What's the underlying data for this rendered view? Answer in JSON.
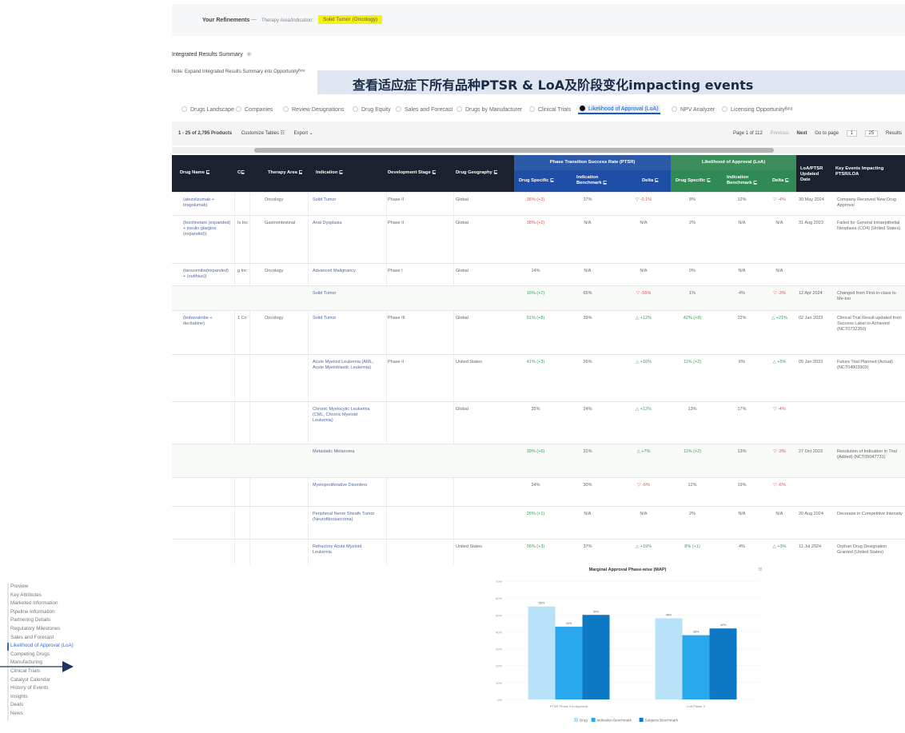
{
  "refinements": {
    "label": "Your Refinements",
    "separator": "—",
    "path": "Therapy Area/Indication:",
    "tag": "Solid Tumor (Oncology)"
  },
  "results_title": "Integrated Results Summary",
  "note": "Note: Expand Integrated Results Summary into Opportunityᴮᵉᵗᵃ",
  "banner": "查看适应症下所有品种PTSR & LoA及阶段变化impacting events",
  "tabs": [
    "Drugs Landscape",
    "Companies",
    "Review Designations",
    "Drug Equity",
    "Sales and Forecast",
    "Drugs by Manufacturer",
    "Clinical Trials",
    "Likelihood of Approval (LoA)",
    "NPV Analyzer",
    "Licensing Opportunityᴮᵉᵗᵃ"
  ],
  "toolbar": {
    "count": "1 - 25 of 2,795 Products",
    "customize": "Customize Tables ☷",
    "export": "Export ⌄",
    "page_of": "Page 1 of 112",
    "previous": "Previous",
    "next": "Next",
    "goto": "Go to page",
    "page_value": "1",
    "per_page": "25",
    "results": "Results"
  },
  "table": {
    "headers": {
      "drug_name": "Drug Name ⊑",
      "company": "C⊑",
      "therapy_area": "Therapy Area ⊑",
      "indication": "Indication ⊑",
      "dev_stage": "Development Stage ⊑",
      "geography": "Drug Geography ⊑",
      "ptsr_group": "Phase Transition Success Rate (PTSR)",
      "loa_group": "Likelihood of Approval (LoA)",
      "drug_specific": "Drug Specific ⊑",
      "indication_bench": "Indication Benchmark ⊑",
      "delta": "Delta ⊑",
      "loa_updated": "LoA/PTSR Updated Date",
      "key_events": "Key Events Impacting PTSR/LOA"
    },
    "rows": [
      {
        "drug": "(atezolizumab + tiragolumab)",
        "company": "",
        "therapy": "Oncology",
        "indication": "Solid Tumor",
        "stage": "Phase II",
        "geo": "Global",
        "p_drug": "36% (+3)",
        "p_bench": "37%",
        "p_delta": "▽ -0.1%",
        "l_drug": "8%",
        "l_bench": "12%",
        "l_delta": "▽ -4%",
        "date": "30 May 2024",
        "event": "Company Received New Drug Approval"
      },
      {
        "drug": "(fezolinetant (expanded) + insulin glargine (expanded))",
        "company": "Is Inc",
        "therapy": "Gastrointestinal",
        "indication": "Anal Dysplasia",
        "stage": "Phase II",
        "geo": "Global",
        "p_drug": "38% (+2)",
        "p_bench": "N/A",
        "p_delta": "N/A",
        "l_drug": "2%",
        "l_bench": "N/A",
        "l_delta": "N/A",
        "date": "31 Aug 2023",
        "event": "Failed for General Intraepithelial Neoplasia (CO4) (United States)"
      },
      {
        "drug": "(tarozomibe(expanded) + (outthius))",
        "company": "g Inc",
        "therapy": "Oncology",
        "indication": "Advanced Malignancy",
        "stage": "Phase I",
        "geo": "Global",
        "p_drug": "14%",
        "p_bench": "N/A",
        "p_delta": "N/A",
        "l_drug": "0%",
        "l_bench": "N/A",
        "l_delta": "N/A",
        "date": "",
        "event": ""
      },
      {
        "drug": "",
        "company": "",
        "therapy": "",
        "indication": "Solid Tumor",
        "stage": "",
        "geo": "",
        "p_drug": "16% (+7)",
        "p_bench": "65%",
        "p_delta": "▽ -55%",
        "l_drug": "1%",
        "l_bench": "4%",
        "l_delta": "▽ -3%",
        "date": "12 Apr 2024",
        "event": "Changed from First-in-class to Me-too"
      },
      {
        "drug": "(bobavatinbe + decitabine)",
        "company": "1 Co",
        "therapy": "Oncology",
        "indication": "Solid Tumor",
        "stage": "Phase III",
        "geo": "Global",
        "p_drug": "51% (+8)",
        "p_bench": "39%",
        "p_delta": "△ +12%",
        "l_drug": "42% (+8)",
        "l_bench": "22%",
        "l_delta": "△ +21%",
        "date": "02 Jan 2023",
        "event": "Clinical Trial Result updated from Success Label to Achieved (NCT0732350)"
      },
      {
        "drug": "",
        "company": "",
        "therapy": "",
        "indication": "Acute Myeloid Leukemia (AML, Acute Myeloblastic Leukemia)",
        "stage": "Phase II",
        "geo": "United States",
        "p_drug": "41% (+3)",
        "p_bench": "26%",
        "p_delta": "△ +16%",
        "l_drug": "11% (+2)",
        "l_bench": "6%",
        "l_delta": "△ +5%",
        "date": "05 Jan 2023",
        "event": "Future Trial Planned (Actual) (NCT04803903)"
      },
      {
        "drug": "",
        "company": "",
        "therapy": "",
        "indication": "Chronic Myelocytic Leukemia (CML, Chronic Myeloid Leukemia)",
        "stage": "",
        "geo": "Global",
        "p_drug": "35%",
        "p_bench": "24%",
        "p_delta": "△ +12%",
        "l_drug": "13%",
        "l_bench": "17%",
        "l_delta": "▽ -4%",
        "date": "",
        "event": ""
      },
      {
        "drug": "",
        "company": "",
        "therapy": "",
        "indication": "Metastatic Melanoma",
        "stage": "",
        "geo": "",
        "p_drug": "39% (+6)",
        "p_bench": "31%",
        "p_delta": "△ +7%",
        "l_drug": "11% (+2)",
        "l_bench": "13%",
        "l_delta": "▽ -3%",
        "date": "27 Oct 2023",
        "event": "Resolution of Indication in Trial (Added) (NCT05047731)"
      },
      {
        "drug": "",
        "company": "",
        "therapy": "",
        "indication": "Myeloproliferative Disorders",
        "stage": "",
        "geo": "",
        "p_drug": "24%",
        "p_bench": "30%",
        "p_delta": "▽ -6%",
        "l_drug": "12%",
        "l_bench": "19%",
        "l_delta": "▽ -6%",
        "date": "",
        "event": ""
      },
      {
        "drug": "",
        "company": "",
        "therapy": "",
        "indication": "Peripheral Nerve Sheath Tumor (Neurofibrosarcoma)",
        "stage": "",
        "geo": "",
        "p_drug": "26% (+1)",
        "p_bench": "N/A",
        "p_delta": "N/A",
        "l_drug": "2%",
        "l_bench": "N/A",
        "l_delta": "N/A",
        "date": "20 Aug 2024",
        "event": "Decrease in Competitive Intensity"
      },
      {
        "drug": "",
        "company": "",
        "therapy": "",
        "indication": "Refractory Acute Myeloid Leukemia",
        "stage": "",
        "geo": "United States",
        "p_drug": "56% (+3)",
        "p_bench": "37%",
        "p_delta": "△ +19%",
        "l_drug": "8% (+1)",
        "l_bench": "4%",
        "l_delta": "△ +3%",
        "date": "11 Jul 2024",
        "event": "Orphan Drug Designation Granted (United States)"
      }
    ]
  },
  "left_nav": {
    "items": [
      "Preview",
      "Key Attributes",
      "Marketed Information",
      "Pipeline Information",
      "Partnering Details",
      "Regulatory Milestones",
      "Sales and Forecast",
      "Likelihood of Approval (LoA)",
      "Competing Drugs",
      "Manufacturing",
      "Clinical Trials",
      "Catalyst Calendar",
      "History of Events",
      "Insights",
      "Deals",
      "News"
    ],
    "active_index": 7
  },
  "colors": {
    "ptsr_blue": "#2d5aa8",
    "loa_green": "#3c8f5d",
    "highlight_yellow": "#f6ef19",
    "drug_series": "#b8e2f8",
    "indication_series": "#29a8ee",
    "subject_series": "#0d79c4"
  },
  "chart_data": {
    "type": "bar",
    "title": "Marginal Approval Phase-wise (MAP)",
    "categories": [
      "PTSR Phase II to Approval",
      "LoA Phase II"
    ],
    "series": [
      {
        "name": "Drug",
        "values": [
          55,
          48
        ]
      },
      {
        "name": "Indication Benchmark",
        "values": [
          43,
          38
        ]
      },
      {
        "name": "Subjects Benchmark",
        "values": [
          50,
          42
        ]
      }
    ],
    "data_labels": [
      [
        "55%",
        "43%",
        "50%"
      ],
      [
        "48%",
        "38%",
        "42%"
      ]
    ],
    "yticks": [
      "70%",
      "60%",
      "50%",
      "40%",
      "30%",
      "20%",
      "10%",
      "0%"
    ],
    "ylim": [
      0,
      70
    ]
  }
}
